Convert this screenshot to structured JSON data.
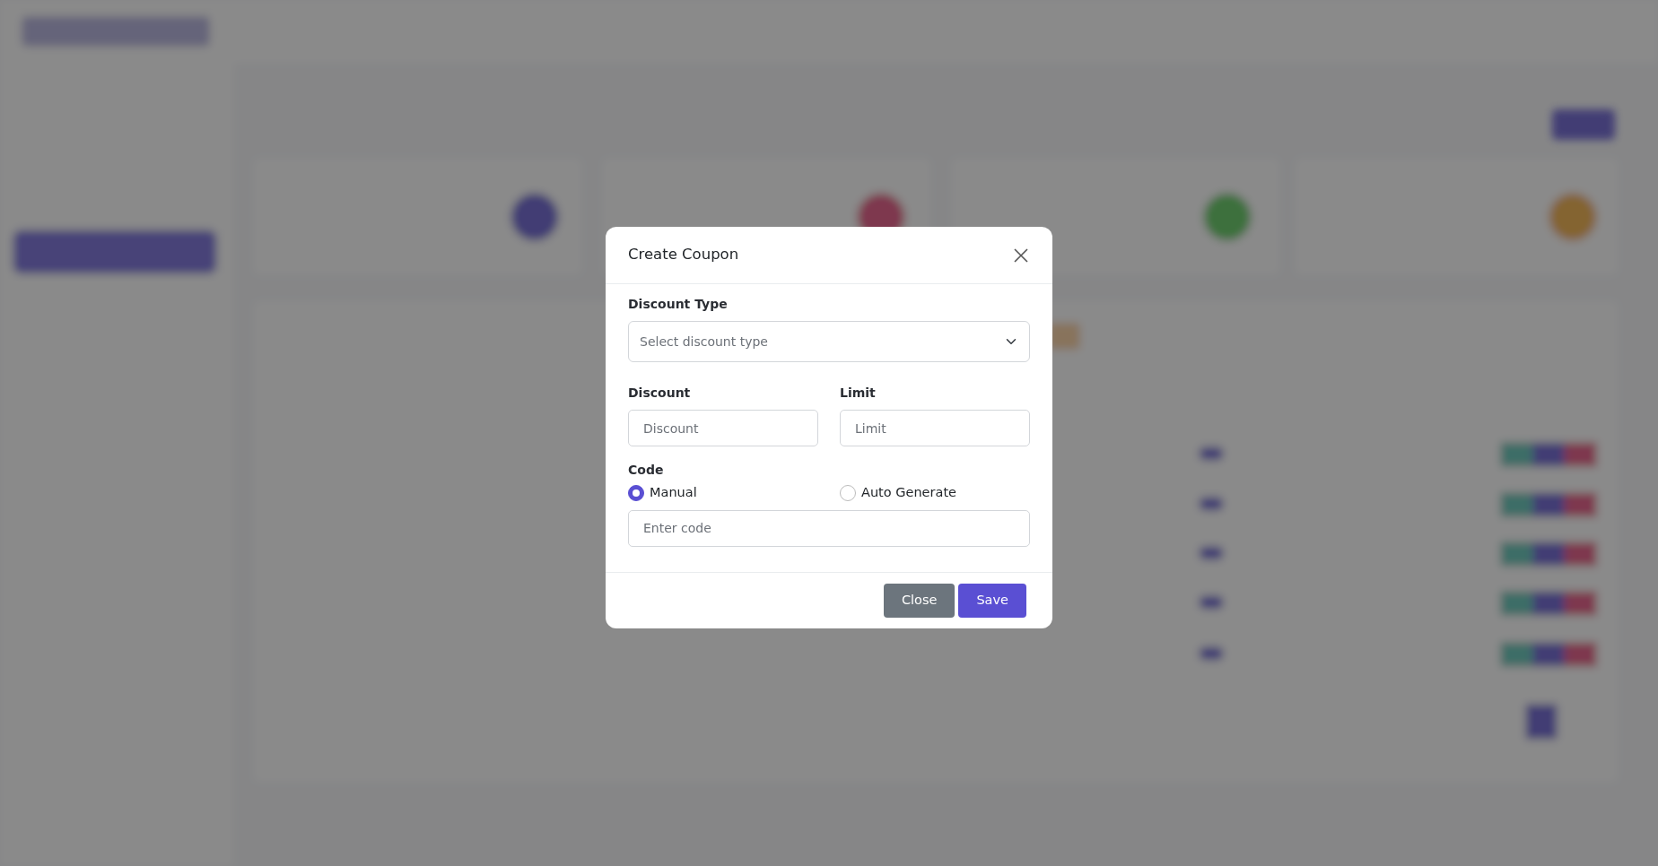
{
  "modal": {
    "title": "Create Coupon",
    "discount_type": {
      "label": "Discount Type",
      "placeholder": "Select discount type"
    },
    "discount": {
      "label": "Discount",
      "placeholder": "Discount"
    },
    "limit": {
      "label": "Limit",
      "placeholder": "Limit"
    },
    "code": {
      "label": "Code",
      "options": [
        {
          "label": "Manual",
          "selected": true
        },
        {
          "label": "Auto Generate",
          "selected": false
        }
      ],
      "placeholder": "Enter code"
    },
    "buttons": [
      {
        "label": "Close",
        "kind": "secondary"
      },
      {
        "label": "Save",
        "kind": "primary"
      }
    ]
  }
}
